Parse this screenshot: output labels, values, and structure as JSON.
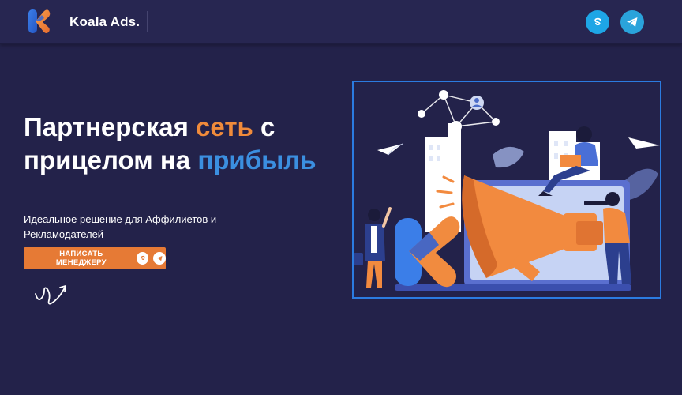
{
  "header": {
    "brand": "Koala Ads.",
    "social": [
      {
        "name": "skype",
        "glyph": "S"
      },
      {
        "name": "telegram",
        "glyph": "➤"
      }
    ]
  },
  "hero": {
    "title_part1": "Партнерская ",
    "title_highlight_orange": "сеть",
    "title_part2": " с прицелом на ",
    "title_highlight_blue": "прибыль",
    "subtitle": "Идеальное решение для Аффилиетов и Рекламодателей",
    "cta_label": "НАПИСАТЬ МЕНЕДЖЕРУ"
  },
  "colors": {
    "background": "#23224a",
    "accent_orange": "#e67a35",
    "accent_blue": "#2b7be0"
  }
}
